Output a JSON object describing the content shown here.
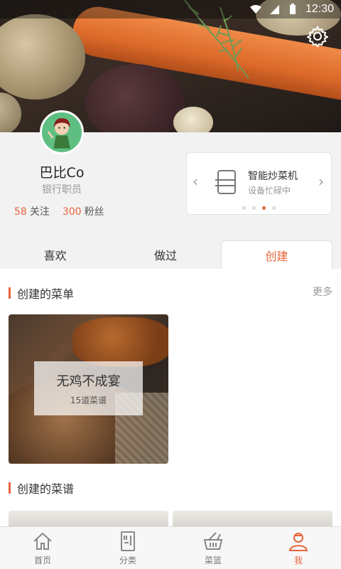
{
  "status_bar": {
    "time": "12:30"
  },
  "profile": {
    "name": "巴比Co",
    "job": "银行职员",
    "following_count": "58",
    "following_label": "关注",
    "followers_count": "300",
    "followers_label": "粉丝"
  },
  "device_card": {
    "title": "智能炒菜机",
    "subtitle": "设备忙碌中",
    "page_count": 4,
    "active_page": 3
  },
  "tabs": [
    {
      "label": "喜欢"
    },
    {
      "label": "做过"
    },
    {
      "label": "创建",
      "active": true
    }
  ],
  "sections": {
    "menus": {
      "title": "创建的菜单",
      "more": "更多"
    },
    "recipes": {
      "title": "创建的菜谱"
    }
  },
  "menu_card": {
    "title": "无鸡不成宴",
    "count": "15道菜谱"
  },
  "bottom_nav": [
    {
      "label": "首页",
      "icon": "home-icon"
    },
    {
      "label": "分类",
      "icon": "category-icon"
    },
    {
      "label": "菜篮",
      "icon": "basket-icon"
    },
    {
      "label": "我",
      "icon": "person-icon",
      "active": true
    }
  ],
  "colors": {
    "accent": "#e8643c",
    "avatar_bg": "#5fbf83"
  }
}
